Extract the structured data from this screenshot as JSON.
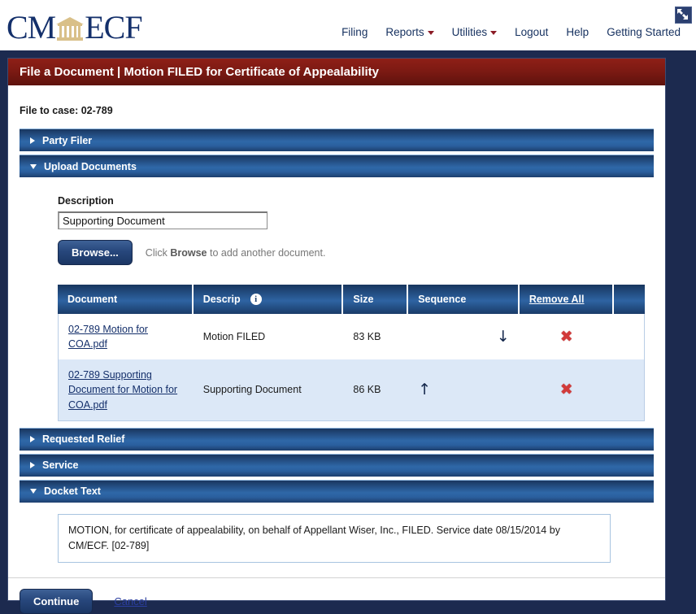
{
  "masthead": {
    "logo": {
      "left_text": "CM",
      "right_text": "ECF",
      "icon": "courthouse-icon"
    },
    "nav": [
      {
        "label": "Filing",
        "has_dropdown": false
      },
      {
        "label": "Reports",
        "has_dropdown": true
      },
      {
        "label": "Utilities",
        "has_dropdown": true
      },
      {
        "label": "Logout",
        "has_dropdown": false
      },
      {
        "label": "Help",
        "has_dropdown": false
      },
      {
        "label": "Getting Started",
        "has_dropdown": false
      }
    ]
  },
  "panel": {
    "title": "File a Document | Motion FILED for Certificate of Appealability",
    "expand_icon": "expand-arrows-icon",
    "file_to_case": "File to case: 02-789"
  },
  "sections": [
    {
      "id": "party-filer",
      "label": "Party Filer",
      "expanded": false
    },
    {
      "id": "upload-documents",
      "label": "Upload Documents",
      "expanded": true
    },
    {
      "id": "requested-relief",
      "label": "Requested Relief",
      "expanded": false
    },
    {
      "id": "service",
      "label": "Service",
      "expanded": false
    },
    {
      "id": "docket-text",
      "label": "Docket Text",
      "expanded": true
    }
  ],
  "upload": {
    "description_label": "Description",
    "description_value": "Supporting Document",
    "description_placeholder": "",
    "browse_label": "Browse...",
    "hint_prefix": "Click ",
    "hint_bold": "Browse",
    "hint_suffix": " to add another document.",
    "table": {
      "headers": {
        "document": "Document",
        "descrip": "Descrip",
        "descrip_info_icon": "info-icon",
        "size": "Size",
        "sequence": "Sequence",
        "remove_all": "Remove All"
      },
      "rows": [
        {
          "document": "02-789 Motion for COA.pdf",
          "descrip": "Motion FILED",
          "size": "83 KB",
          "sequence_icon": "arrow-down-icon",
          "sequence_glyph": "↓",
          "remove_icon": "remove-x-icon",
          "remove_glyph": "✖"
        },
        {
          "document": "02-789 Supporting Document for Motion for COA.pdf",
          "descrip": "Supporting Document",
          "size": "86 KB",
          "sequence_icon": "arrow-up-icon",
          "sequence_glyph": "↑",
          "remove_icon": "remove-x-icon",
          "remove_glyph": "✖"
        }
      ]
    }
  },
  "docket": {
    "text": "MOTION, for certificate of appealability, on behalf of Appellant Wiser, Inc., FILED. Service date 08/15/2014 by CM/ECF. [02-789]"
  },
  "footer": {
    "continue_label": "Continue",
    "cancel_label": "Cancel"
  },
  "colors": {
    "title_red": "#7d1a13",
    "section_blue": "#2f68a8",
    "page_navy": "#1c2a4f",
    "link_navy": "#15306b",
    "remove_red": "#d23a3a",
    "logo_navy": "#14306b",
    "logo_gold": "#d9c089"
  }
}
